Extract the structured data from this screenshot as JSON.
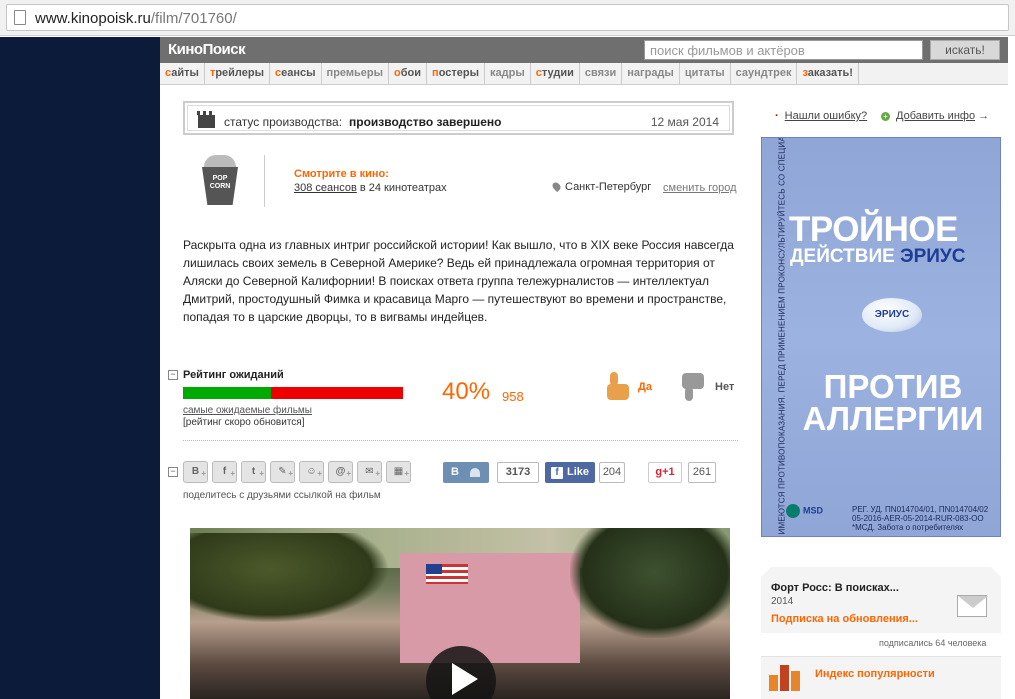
{
  "browser": {
    "url_host": "www.kinopoisk.ru",
    "url_path": "/film/701760/"
  },
  "header": {
    "logo": "КиноПоиск",
    "search_placeholder": "поиск фильмов и актёров",
    "search_button": "искать!"
  },
  "nav": {
    "items": [
      {
        "initial": "с",
        "rest": "айты"
      },
      {
        "initial": "т",
        "rest": "рейлеры"
      },
      {
        "initial": "с",
        "rest": "еансы"
      },
      {
        "initial": "",
        "rest": "премьеры"
      },
      {
        "initial": "о",
        "rest": "бои"
      },
      {
        "initial": "п",
        "rest": "остеры"
      },
      {
        "initial": "",
        "rest": "кадры"
      },
      {
        "initial": "с",
        "rest": "тудии"
      },
      {
        "initial": "",
        "rest": "связи"
      },
      {
        "initial": "",
        "rest": "награды"
      },
      {
        "initial": "",
        "rest": "цитаты"
      },
      {
        "initial": "",
        "rest": "саундтрек"
      },
      {
        "initial": "з",
        "rest": "аказать!"
      }
    ]
  },
  "status": {
    "label": "статус производства:",
    "value": "производство завершено",
    "date": "12 мая 2014"
  },
  "cinema": {
    "popcorn": "POP CORN",
    "title": "Смотрите в кино:",
    "sessions_link": "308 сеансов",
    "sessions_rest": " в 24 кинотеатрах",
    "city": "Санкт-Петербург",
    "change_city": "сменить город"
  },
  "description": "Раскрыта одна из главных интриг российской истории! Как вышло, что в XIX веке Россия навсегда лишилась своих земель в Северной Америке? Ведь ей принадлежала огромная территория от Аляски до Северной Калифорнии! В поисках ответа группа тележурналистов — интеллектуал Дмитрий, простодушный Фимка и красавица Марго — путешествуют во времени и пространстве, попадая то в царские дворцы, то в вигвамы индейцев.",
  "rating": {
    "toggle": "−",
    "title": "Рейтинг ожиданий",
    "percent": "40%",
    "percent_value": 40,
    "votes": "958",
    "link": "самые ожидаемые фильмы",
    "note": "[рейтинг скоро обновится]",
    "yes": "Да",
    "no": "Нет",
    "color_positive": "#00aa00",
    "color_negative": "#ee0000"
  },
  "share": {
    "toggle": "−",
    "icons": [
      "vk-icon",
      "facebook-icon",
      "twitter-icon",
      "livejournal-icon",
      "odnoklassniki-icon",
      "moimir-icon",
      "email-icon",
      "qr-icon"
    ],
    "caption": "поделитесь с друзьями ссылкой на фильм",
    "vk_label": "В",
    "vk_count": "3173",
    "fb_label": "Like",
    "fb_count": "204",
    "gp_label": "g+1",
    "gp_count": "261"
  },
  "sidebar": {
    "report_error": "Нашли ошибку?",
    "add_info": "Добавить инфо",
    "add_info_arrow": "→",
    "ad": {
      "line1": "ТРОЙНОЕ",
      "line2a": "ДЕЙСТВИЕ ",
      "line2b": "ЭРИУС",
      "pill": "ЭРИУС",
      "line3": "ПРОТИВ АЛЛЕРГИИ",
      "vertical": "ИМЕЮТСЯ ПРОТИВОПОКАЗАНИЯ. ПЕРЕД ПРИМЕНЕНИЕМ ПРОКОНСУЛЬТИРУЙТЕСЬ СО СПЕЦИАЛИСТОМ",
      "brand": "MSD",
      "reg": "РЕГ. УД. ПN014704/01, ПN014704/02 05-2016-AER-05-2014-RUR-083-OO *МСД. Забота о потребителях"
    },
    "subscribe": {
      "title": "Форт Росс: В поисках...",
      "year": "2014",
      "link": "Подписка на обновления...",
      "count": "подписались 64 человека"
    },
    "popularity": "Индекс популярности"
  }
}
